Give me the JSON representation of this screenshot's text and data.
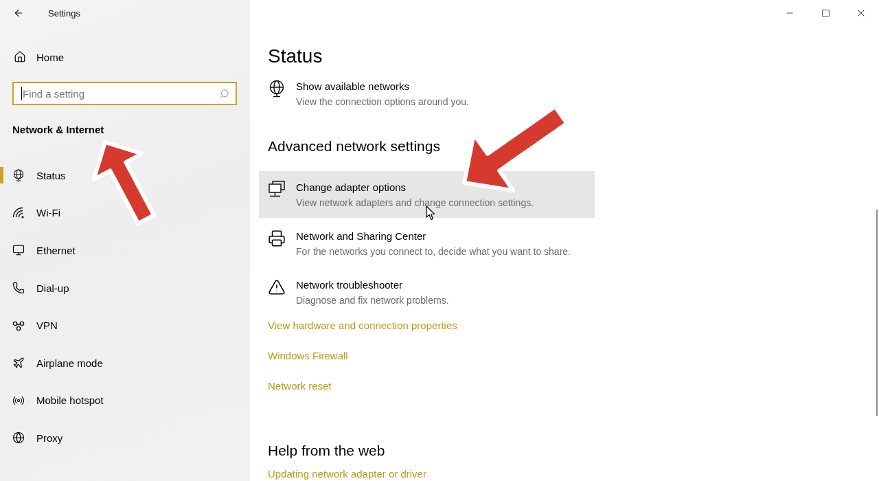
{
  "window": {
    "title": "Settings"
  },
  "sidebar": {
    "home": "Home",
    "search": {
      "placeholder": "Find a setting",
      "focused": true
    },
    "section_title": "Network & Internet",
    "items": [
      {
        "label": "Status",
        "selected": true
      },
      {
        "label": "Wi-Fi",
        "selected": false
      },
      {
        "label": "Ethernet",
        "selected": false
      },
      {
        "label": "Dial-up",
        "selected": false
      },
      {
        "label": "VPN",
        "selected": false
      },
      {
        "label": "Airplane mode",
        "selected": false
      },
      {
        "label": "Mobile hotspot",
        "selected": false
      },
      {
        "label": "Proxy",
        "selected": false
      }
    ]
  },
  "main": {
    "title": "Status",
    "top_items": [
      {
        "title": "Show available networks",
        "description": "View the connection options around you.",
        "highlighted": false
      }
    ],
    "advanced": {
      "heading": "Advanced network settings",
      "items": [
        {
          "title": "Change adapter options",
          "description": "View network adapters and change connection settings.",
          "highlighted": true
        },
        {
          "title": "Network and Sharing Center",
          "description": "For the networks you connect to, decide what you want to share.",
          "highlighted": false
        },
        {
          "title": "Network troubleshooter",
          "description": "Diagnose and fix network problems.",
          "highlighted": false
        }
      ],
      "links": [
        "View hardware and connection properties",
        "Windows Firewall",
        "Network reset"
      ]
    },
    "help": {
      "heading": "Help from the web",
      "links": [
        "Updating network adapter or driver"
      ]
    }
  }
}
